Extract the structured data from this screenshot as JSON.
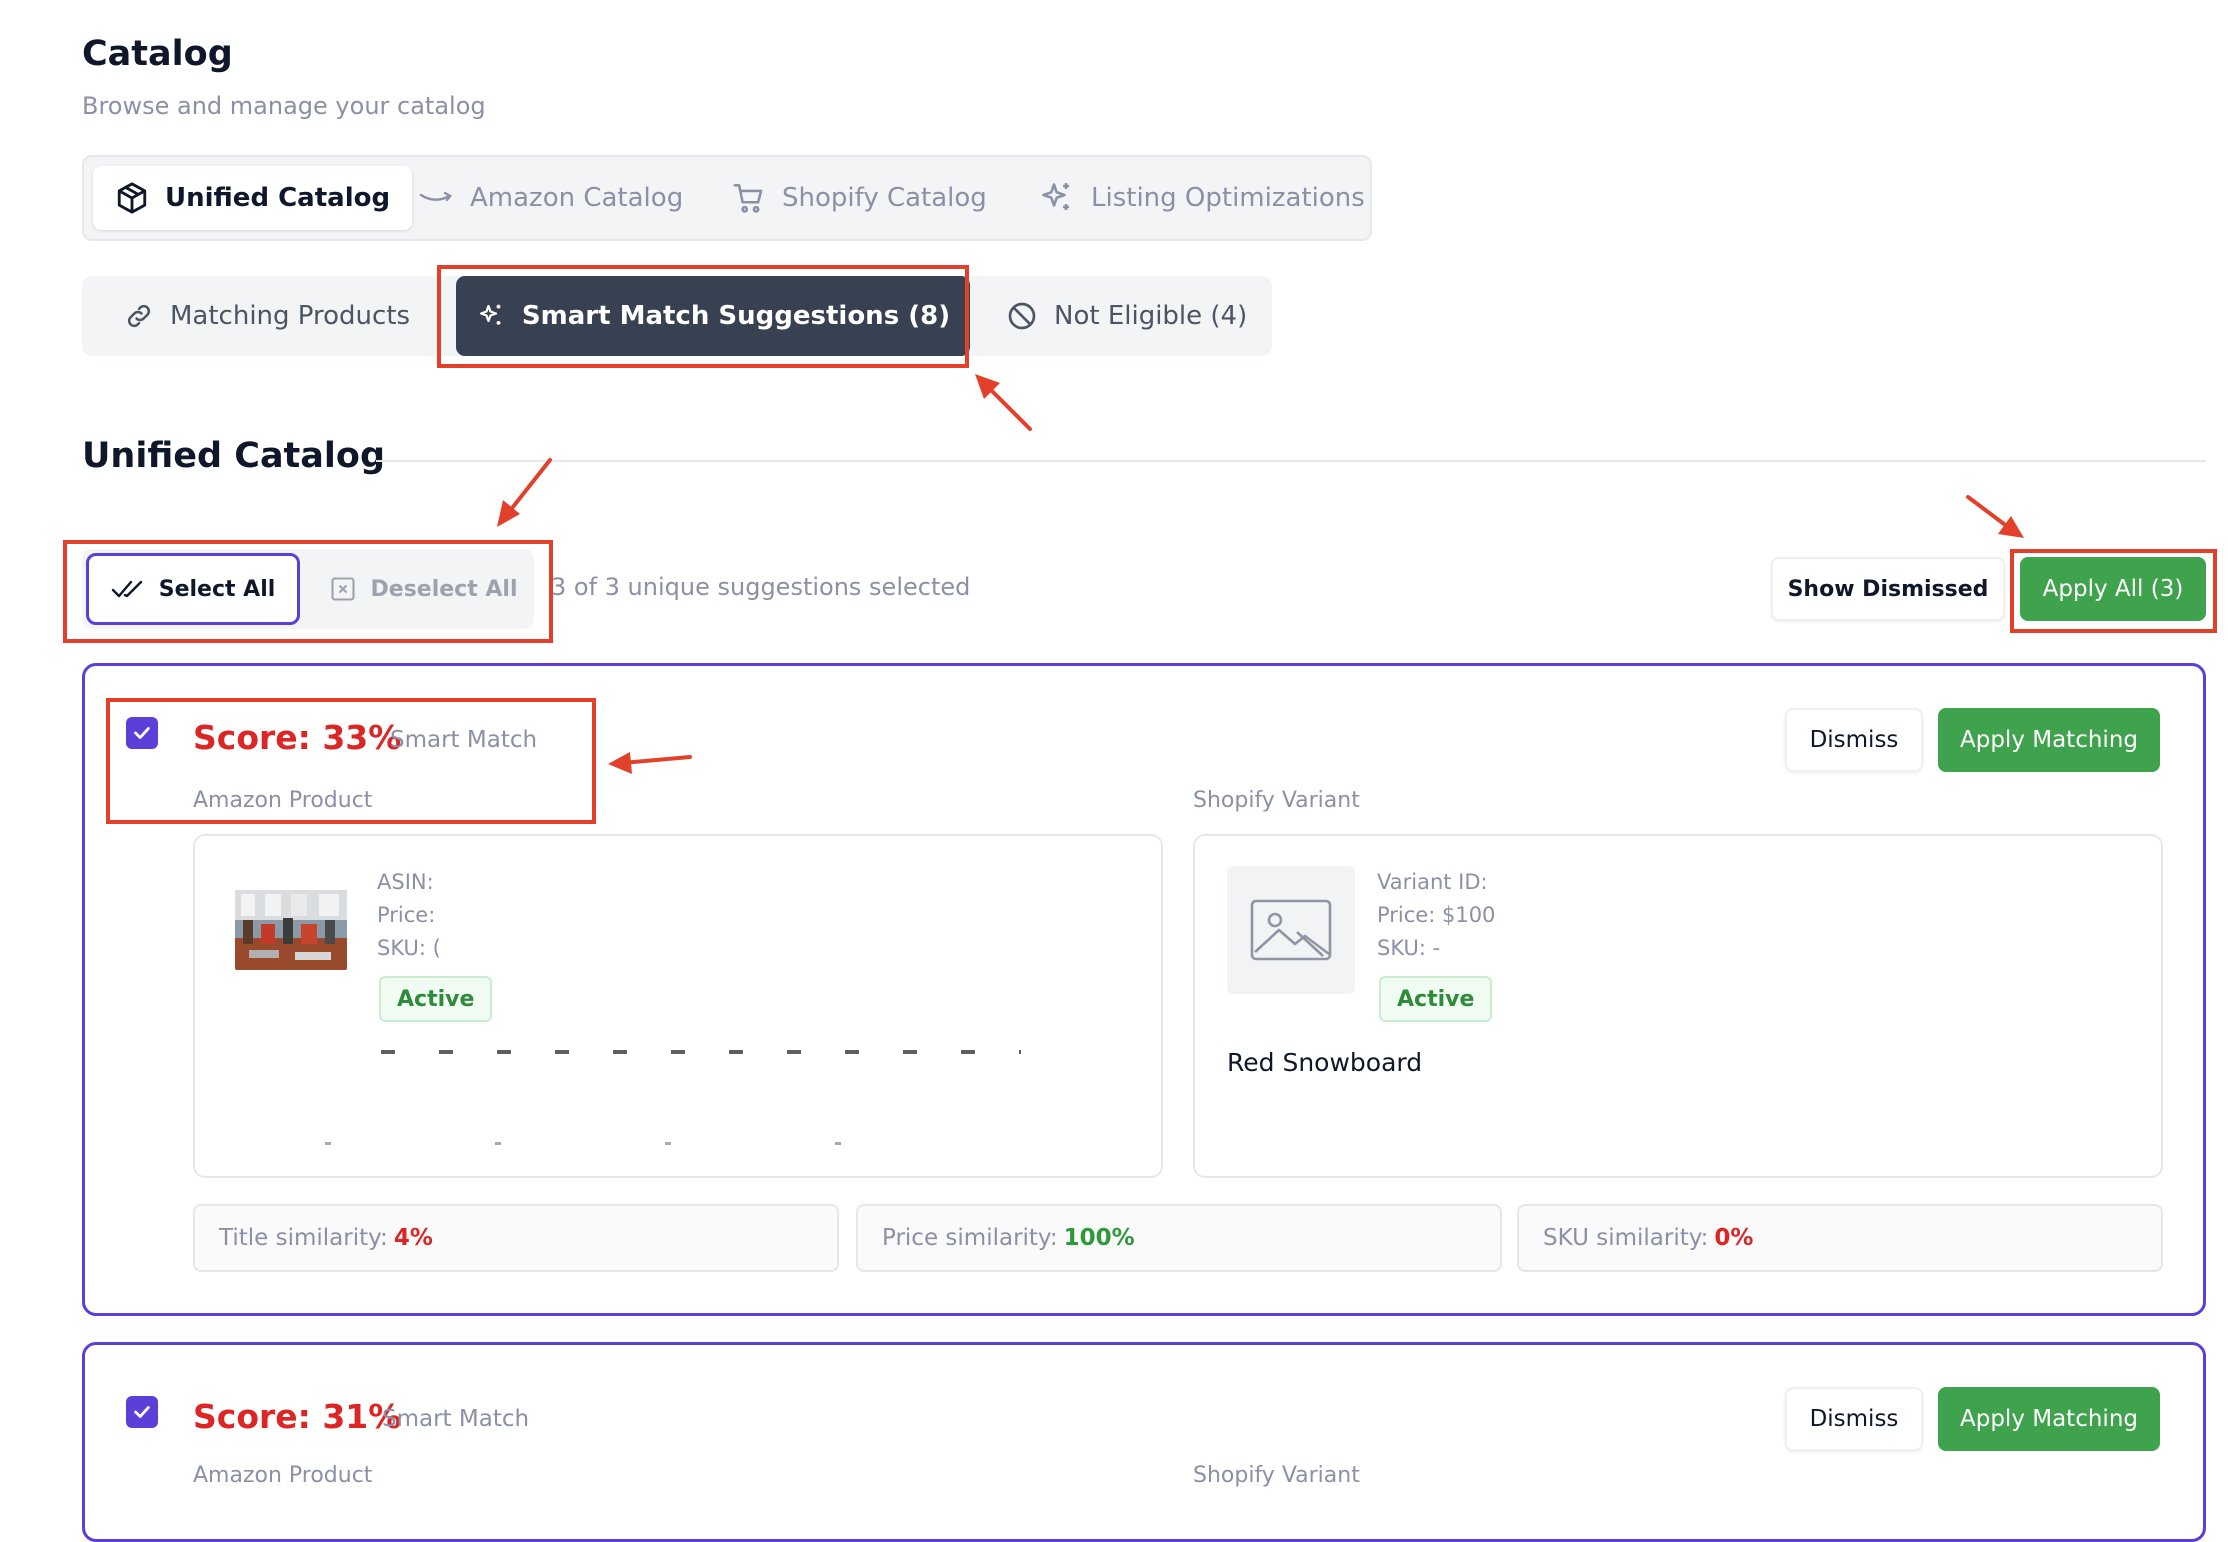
{
  "header": {
    "title": "Catalog",
    "subtitle": "Browse and manage your catalog"
  },
  "top_tabs": [
    {
      "label": "Unified Catalog",
      "icon": "cube-icon",
      "active": true
    },
    {
      "label": "Amazon Catalog",
      "icon": "amazon-smile-icon",
      "active": false
    },
    {
      "label": "Shopify Catalog",
      "icon": "cart-icon",
      "active": false
    },
    {
      "label": "Listing Optimizations",
      "icon": "sparkles-icon",
      "active": false
    }
  ],
  "sub_tabs": [
    {
      "label": "Matching Products",
      "icon": "link-icon",
      "active": false
    },
    {
      "label": "Smart Match Suggestions (8)",
      "icon": "sparkles-icon",
      "active": true
    },
    {
      "label": "Not Eligible (4)",
      "icon": "ban-icon",
      "active": false
    }
  ],
  "section": {
    "title": "Unified Catalog"
  },
  "selection": {
    "select_all": "Select All",
    "deselect_all": "Deselect All",
    "count_text": "3 of 3 unique suggestions selected",
    "show_dismissed": "Show Dismissed",
    "apply_all": "Apply All (3)"
  },
  "cards": [
    {
      "score": "Score: 33%",
      "tag": "Smart Match",
      "amazon_label": "Amazon Product",
      "shopify_label": "Shopify Variant",
      "dismiss": "Dismiss",
      "apply": "Apply Matching",
      "amazon": {
        "asin": "ASIN:",
        "price": "Price:",
        "sku": "SKU: (",
        "status": "Active"
      },
      "shopify": {
        "variant_id": "Variant ID:",
        "price": "Price: $100",
        "sku": "SKU: -",
        "status": "Active",
        "title": "Red Snowboard"
      },
      "similarity": [
        {
          "label": "Title similarity:",
          "value": "4%",
          "tone": "red"
        },
        {
          "label": "Price similarity:",
          "value": "100%",
          "tone": "green"
        },
        {
          "label": "SKU similarity:",
          "value": "0%",
          "tone": "red"
        }
      ]
    },
    {
      "score": "Score: 31%",
      "tag": "Smart Match",
      "amazon_label": "Amazon Product",
      "shopify_label": "Shopify Variant",
      "dismiss": "Dismiss",
      "apply": "Apply Matching"
    }
  ],
  "colors": {
    "accent": "#5b3fd8",
    "success": "#3fa34d",
    "danger": "#dc2626",
    "annotation": "#e2402a",
    "dark_tab": "#374151"
  }
}
